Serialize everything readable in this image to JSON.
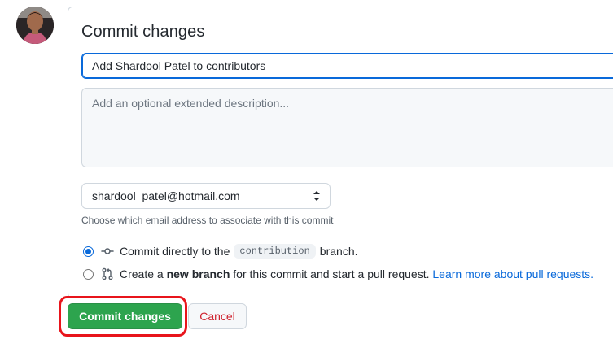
{
  "form": {
    "title": "Commit changes",
    "summary_value": "Add Shardool Patel to contributors",
    "description_placeholder": "Add an optional extended description...",
    "email_selected": "shardool_patel@hotmail.com",
    "email_hint": "Choose which email address to associate with this commit"
  },
  "options": {
    "direct": {
      "checked": true,
      "text_before": "Commit directly to the",
      "branch": "contribution",
      "text_after": "branch."
    },
    "new_branch": {
      "checked": false,
      "text_before": "Create a",
      "bold": "new branch",
      "text_after": "for this commit and start a pull request.",
      "link": "Learn more about pull requests."
    }
  },
  "actions": {
    "commit_label": "Commit changes",
    "cancel_label": "Cancel"
  },
  "icons": {
    "direct": "git-commit-icon",
    "new_branch": "git-pull-request-icon",
    "select": "select-arrows-icon"
  },
  "colors": {
    "primary_green": "#2da44e",
    "link_blue": "#0969da",
    "danger_red": "#cf222e",
    "annotation_red": "#e8141b"
  }
}
